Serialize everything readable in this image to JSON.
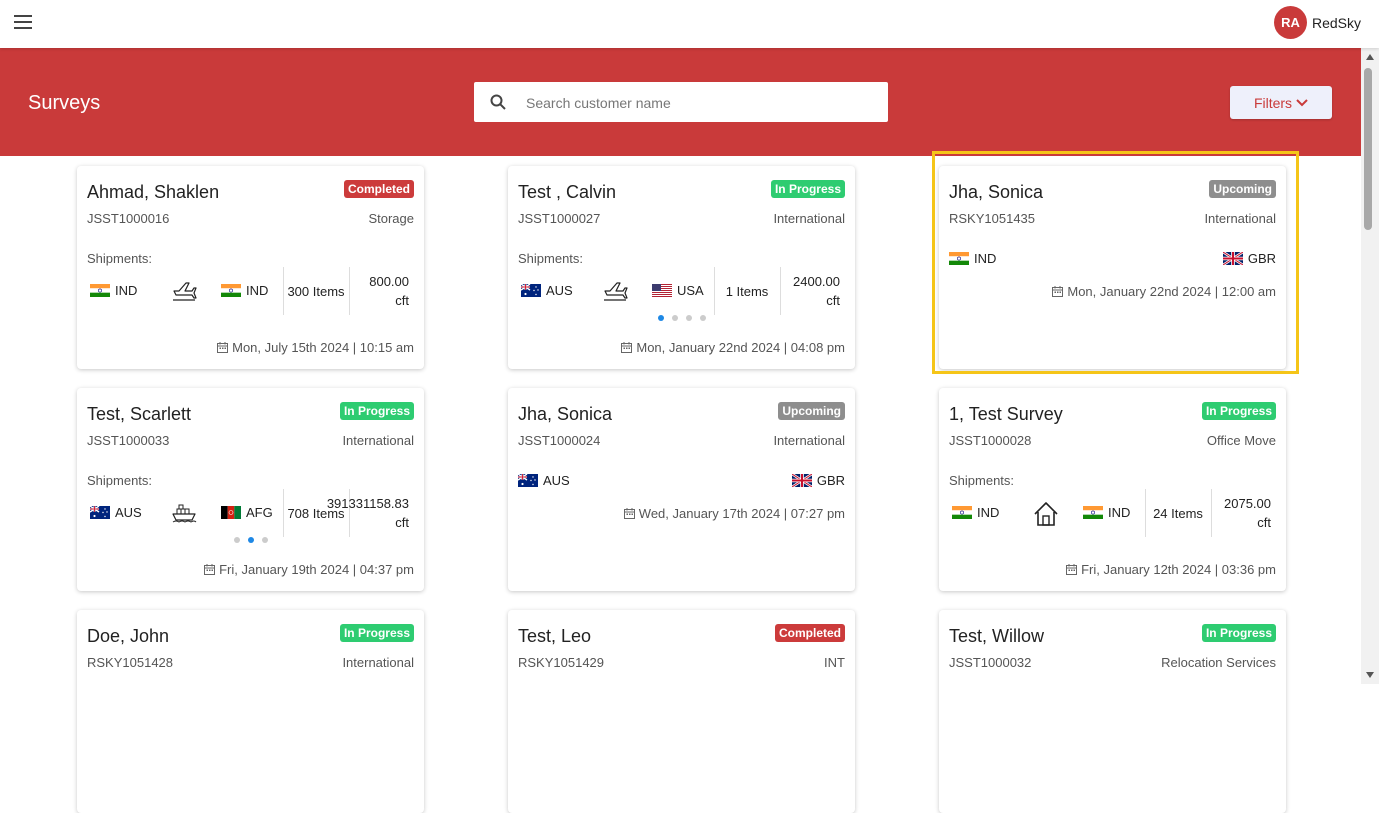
{
  "header": {
    "avatar_initials": "RA",
    "username": "RedSky"
  },
  "banner": {
    "title": "Surveys",
    "search_placeholder": "Search customer name",
    "filters_label": "Filters"
  },
  "colors": {
    "brand": "#c93a3a",
    "completed": "#cc3b3b",
    "in_progress": "#2ecc71",
    "upcoming": "#8e8e8e",
    "highlight": "#f5c518",
    "active_dot": "#1e88e5"
  },
  "cards": [
    {
      "name": "Ahmad, Shaklen",
      "status": "Completed",
      "code": "JSST1000016",
      "type": "Storage",
      "shipments_label": "Shipments:",
      "origin": "IND",
      "destination": "IND",
      "mode_icon": "plane-icon",
      "items": "300 Items",
      "volume": "800.00 cft",
      "datetime": "Mon, July 15th 2024 | 10:15 am"
    },
    {
      "name": "Test , Calvin",
      "status": "In Progress",
      "code": "JSST1000027",
      "type": "International",
      "shipments_label": "Shipments:",
      "origin": "AUS",
      "destination": "USA",
      "mode_icon": "plane-icon",
      "items": "1 Items",
      "volume": "2400.00 cft",
      "carousel_dots": 4,
      "active_dot": 1,
      "datetime": "Mon, January 22nd 2024 | 04:08 pm"
    },
    {
      "name": "Jha, Sonica",
      "status": "Upcoming",
      "code": "RSKY1051435",
      "type": "International",
      "origin": "IND",
      "destination": "GBR",
      "datetime": "Mon, January 22nd 2024 | 12:00 am"
    },
    {
      "name": "Test, Scarlett",
      "status": "In Progress",
      "code": "JSST1000033",
      "type": "International",
      "shipments_label": "Shipments:",
      "origin": "AUS",
      "destination": "AFG",
      "mode_icon": "ship-icon",
      "items": "708 Items",
      "volume": "391331158.83 cft",
      "carousel_dots": 3,
      "active_dot": 2,
      "datetime": "Fri, January 19th 2024 | 04:37 pm"
    },
    {
      "name": "Jha, Sonica",
      "status": "Upcoming",
      "code": "JSST1000024",
      "type": "International",
      "origin": "AUS",
      "destination": "GBR",
      "datetime": "Wed, January 17th 2024 | 07:27 pm"
    },
    {
      "name": "1, Test Survey",
      "status": "In Progress",
      "code": "JSST1000028",
      "type": "Office Move",
      "shipments_label": "Shipments:",
      "origin": "IND",
      "destination": "IND",
      "mode_icon": "house-icon",
      "items": "24 Items",
      "volume": "2075.00 cft",
      "datetime": "Fri, January 12th 2024 | 03:36 pm"
    },
    {
      "name": "Doe, John",
      "status": "In Progress",
      "code": "RSKY1051428",
      "type": "International"
    },
    {
      "name": "Test, Leo",
      "status": "Completed",
      "code": "RSKY1051429",
      "type": "INT"
    },
    {
      "name": "Test, Willow",
      "status": "In Progress",
      "code": "JSST1000032",
      "type": "Relocation Services"
    }
  ]
}
